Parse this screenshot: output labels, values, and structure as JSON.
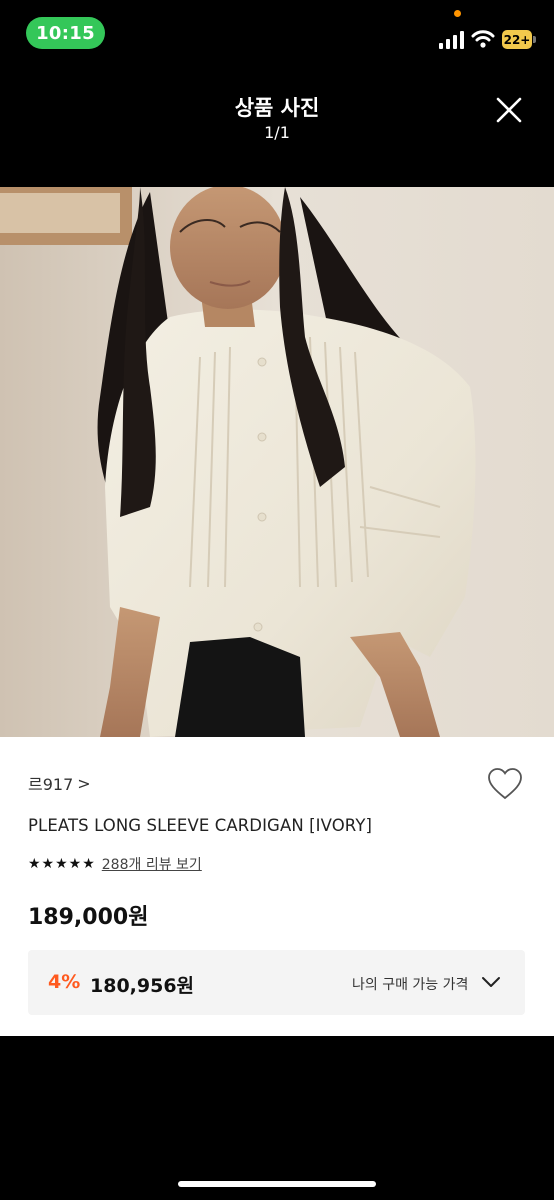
{
  "status_bar": {
    "time": "10:15",
    "battery": "22+"
  },
  "header": {
    "title": "상품 사진",
    "counter": "1/1"
  },
  "photo": {
    "description_icon": "product-photo"
  },
  "product": {
    "brand": "르917",
    "brand_chevron": ">",
    "name": "PLEATS LONG SLEEVE CARDIGAN [IVORY]",
    "stars": "★★★★★",
    "rating_value": 5,
    "review_text": "288개 리뷰 보기",
    "price": "189,000원",
    "discount_rate": "4%",
    "discount_price": "180,956원",
    "my_price_label": "나의 구매 가능 가격"
  },
  "colors": {
    "accent_discount": "#ff5a1f",
    "time_pill": "#34c759",
    "battery": "#f2c94c"
  }
}
